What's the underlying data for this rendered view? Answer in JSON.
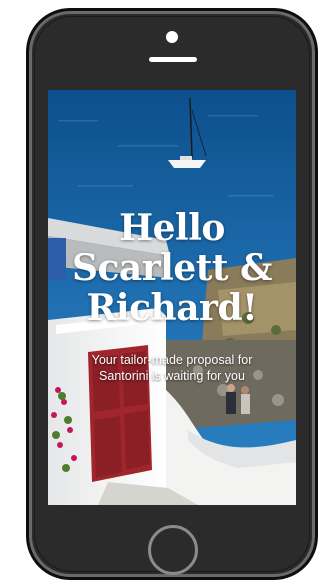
{
  "greeting": {
    "title": "Hello\nScarlett &\nRichard!",
    "subtitle": "Your tailor-made proposal for\nSantorini is waiting for you"
  },
  "icons": {
    "camera": "camera-icon",
    "speaker": "speaker-icon",
    "home": "home-button-icon"
  },
  "colors": {
    "sea": "#1b5f9a",
    "phone_body": "#2b2b2b",
    "door": "#a0252c",
    "walls": "#f4f4f2"
  }
}
